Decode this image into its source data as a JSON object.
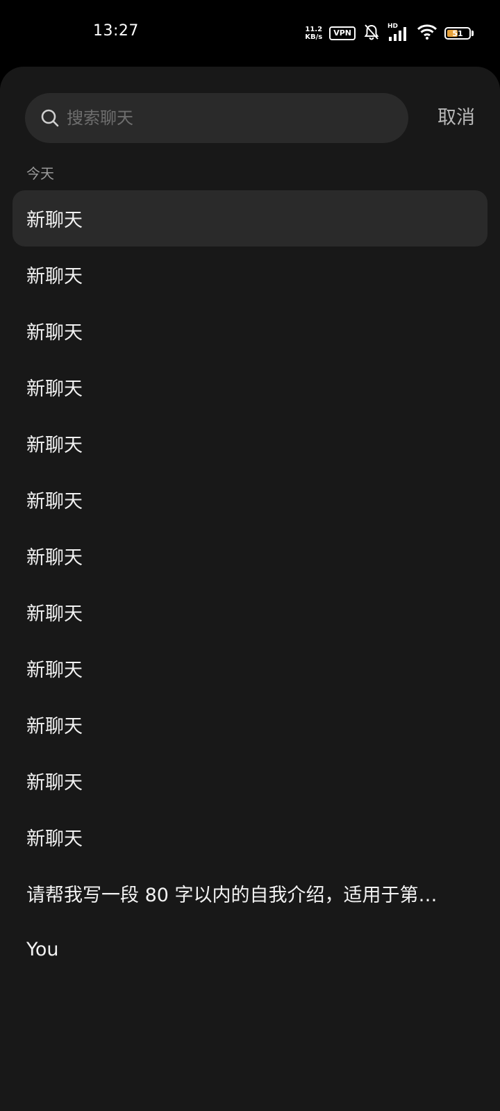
{
  "status_bar": {
    "time": "13:27",
    "net_speed_value": "11.2",
    "net_speed_unit": "KB/s",
    "vpn": "VPN",
    "signal_label": "HD",
    "battery_level": "51",
    "battery_fraction": 0.51,
    "battery_color": "#e6a23c"
  },
  "search": {
    "placeholder": "搜索聊天",
    "value": "",
    "cancel_label": "取消"
  },
  "section": {
    "title": "今天"
  },
  "chats": [
    {
      "title": "新聊天",
      "selected": true
    },
    {
      "title": "新聊天"
    },
    {
      "title": "新聊天"
    },
    {
      "title": "新聊天"
    },
    {
      "title": "新聊天"
    },
    {
      "title": "新聊天"
    },
    {
      "title": "新聊天"
    },
    {
      "title": "新聊天"
    },
    {
      "title": "新聊天"
    },
    {
      "title": "新聊天"
    },
    {
      "title": "新聊天"
    },
    {
      "title": "新聊天"
    },
    {
      "title": "请帮我写一段 80 字以内的自我介绍，适用于第…"
    },
    {
      "title": "You"
    }
  ]
}
